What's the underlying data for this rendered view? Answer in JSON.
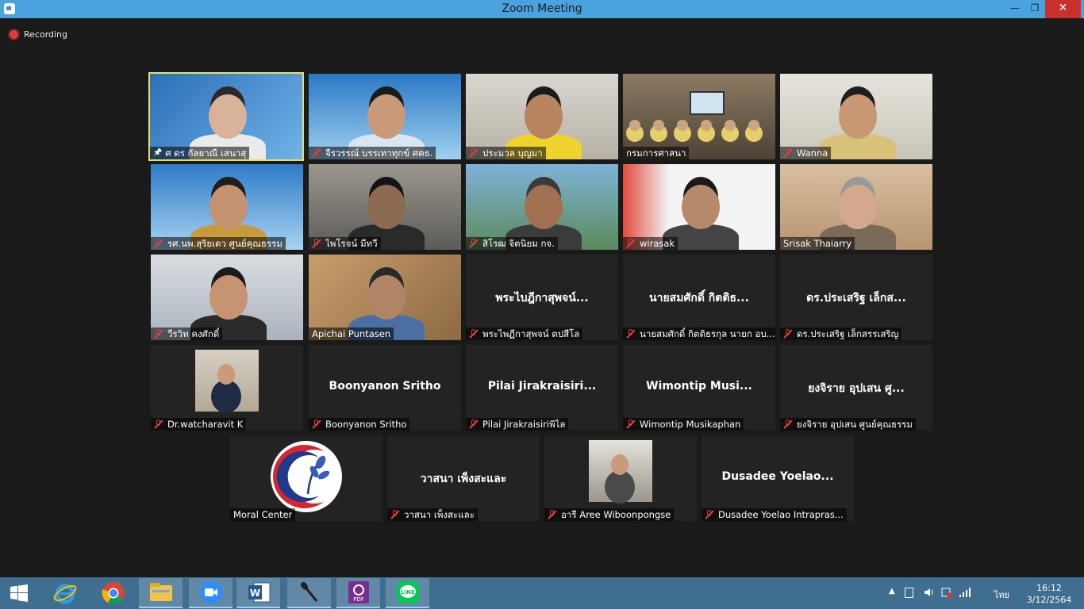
{
  "window": {
    "title": "Zoom Meeting",
    "minimize": "—",
    "maximize": "❐",
    "close": "✕"
  },
  "recording": {
    "label": "Recording"
  },
  "participants": [
    {
      "name": "ศ ดร กัลยาณี เสนาสุ",
      "kind": "video",
      "active": true,
      "pinned": true
    },
    {
      "name": "จีรวรรณ์ บรรเทาทุกข์ ศคธ.",
      "kind": "video",
      "muted": true
    },
    {
      "name": "ประมวล บุญมา",
      "kind": "video",
      "muted": true
    },
    {
      "name": "กรมการศาสนา",
      "kind": "video"
    },
    {
      "name": "Wanna",
      "kind": "video",
      "muted": true
    },
    {
      "name": "รศ.นพ.สุริยเดว ศูนย์คุณธรรม",
      "kind": "video",
      "muted": true
    },
    {
      "name": "ไพโรจน์ มีทวี",
      "kind": "video",
      "muted": true
    },
    {
      "name": "สิโรฒ จิตนิยม กจ.",
      "kind": "video",
      "muted": true
    },
    {
      "name": "wirasak",
      "kind": "video",
      "muted": true
    },
    {
      "name": "Srisak Thaiarry",
      "kind": "video"
    },
    {
      "name": "วีรวิท คงศักดิ์",
      "kind": "video",
      "muted": true
    },
    {
      "name": "Apichai Puntasen",
      "kind": "video"
    },
    {
      "name": "พระไพฏีกาสุพจน์  ตปสีโล",
      "display": "พระไบฎีกาสุพจน์...",
      "kind": "name",
      "muted": true
    },
    {
      "name": "นายสมศักดิ์ กิตติธรกุล นายก อบ...",
      "display": "นายสมศักดิ์ กิตติธ...",
      "kind": "name",
      "muted": true
    },
    {
      "name": "ดร.ประเสริฐ เล็กสรรเสริญ",
      "display": "ดร.ประเสริฐ เล็กส...",
      "kind": "name",
      "muted": true
    },
    {
      "name": "Dr.watcharavit K",
      "kind": "photo",
      "muted": true
    },
    {
      "name": "Boonyanon Sritho",
      "display": "Boonyanon Sritho",
      "kind": "name",
      "muted": true
    },
    {
      "name": "Pilai Jirakraisiriพิไล",
      "display": "Pilai  Jirakraisiri...",
      "kind": "name",
      "muted": true
    },
    {
      "name": "Wimontip Musikaphan",
      "display": "Wimontip  Musi...",
      "kind": "name",
      "muted": true
    },
    {
      "name": "ยงจิราย  อุปเสน ศูนย์คุณธรรม",
      "display": "ยงจิราย  อุปเสน ศู...",
      "kind": "name",
      "muted": true
    },
    {
      "name": "Moral Center",
      "kind": "logo"
    },
    {
      "name": "วาสนา เพ็งสะและ",
      "display": "วาสนา เพ็งสะและ",
      "kind": "name",
      "muted": true
    },
    {
      "name": "อารี Aree Wiboonpongse",
      "kind": "photo",
      "muted": true
    },
    {
      "name": "Dusadee  Yoelao Intrapras...",
      "display": "Dusadee   Yoelao...",
      "kind": "name",
      "muted": true
    }
  ],
  "taskbar": {
    "apps": [
      "start",
      "internet-explorer",
      "chrome",
      "file-explorer",
      "zoom",
      "word",
      "microphone",
      "pdf",
      "line"
    ],
    "language": "ไทย",
    "time": "16:12",
    "date": "3/12/2564"
  },
  "colors": {
    "title_bar": "#4aa3df",
    "taskbar": "#3f6e91",
    "active_speaker": "#e8e25a",
    "muted": "#e04040"
  }
}
